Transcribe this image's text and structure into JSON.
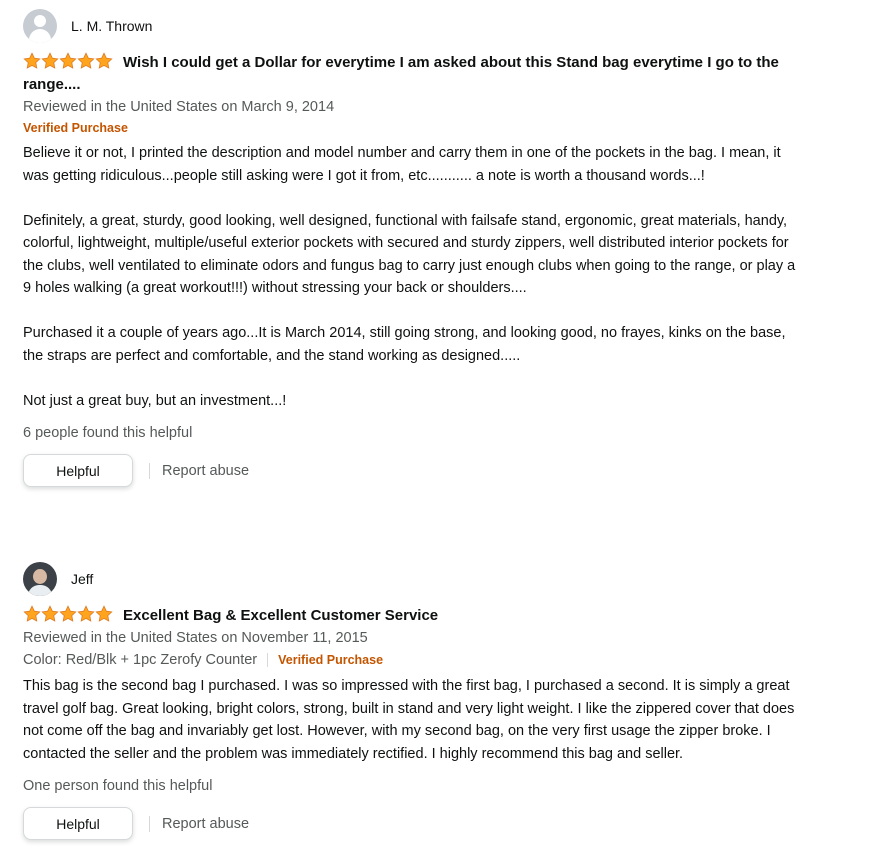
{
  "reviews": [
    {
      "author": "L. M. Thrown",
      "avatar_icon": "default-avatar-icon",
      "rating": 5,
      "title": "Wish I could get a Dollar for everytime I am asked about this Stand bag everytime I go to the range....",
      "reviewed_in": "Reviewed in the United States on March 9, 2014",
      "verified": "Verified Purchase",
      "body": "Believe it or not, I printed the description and model number and carry them in one of the pockets in the bag. I mean, it was getting ridiculous...people still asking were I got it from, etc........... a note is worth a thousand words...!\n\nDefinitely, a great, sturdy, good looking, well designed, functional with failsafe stand, ergonomic, great materials, handy, colorful, lightweight, multiple/useful exterior pockets with secured and sturdy zippers, well distributed interior pockets for the clubs, well ventilated to eliminate odors and fungus bag to carry just enough clubs when going to the range, or play a 9 holes walking (a great workout!!!) without stressing your back or shoulders....\n\nPurchased it a couple of years ago...It is March 2014, still going strong, and looking good, no frayes, kinks on the base, the straps are perfect and comfortable, and the stand working as designed.....\n\nNot just a great buy, but an investment...!",
      "helpful_count": "6 people found this helpful",
      "helpful_button": "Helpful",
      "report": "Report abuse"
    },
    {
      "author": "Jeff",
      "avatar_icon": "profile-photo-avatar",
      "rating": 5,
      "title": "Excellent Bag & Excellent Customer Service",
      "reviewed_in": "Reviewed in the United States on November 11, 2015",
      "format": "Color: Red/Blk + 1pc Zerofy Counter",
      "verified": "Verified Purchase",
      "body": "This bag is the second bag I purchased. I was so impressed with the first bag, I purchased a second. It is simply a great travel golf bag. Great looking, bright colors, strong, built in stand and very light weight. I like the zippered cover that does not come off the bag and invariably get lost. However, with my second bag, on the very first usage the zipper broke. I contacted the seller and the problem was immediately rectified. I highly recommend this bag and seller.",
      "helpful_count": "One person found this helpful",
      "helpful_button": "Helpful",
      "report": "Report abuse"
    }
  ],
  "colors": {
    "star": "#ffa41c",
    "verified": "#c45500",
    "muted_text": "#565959"
  }
}
